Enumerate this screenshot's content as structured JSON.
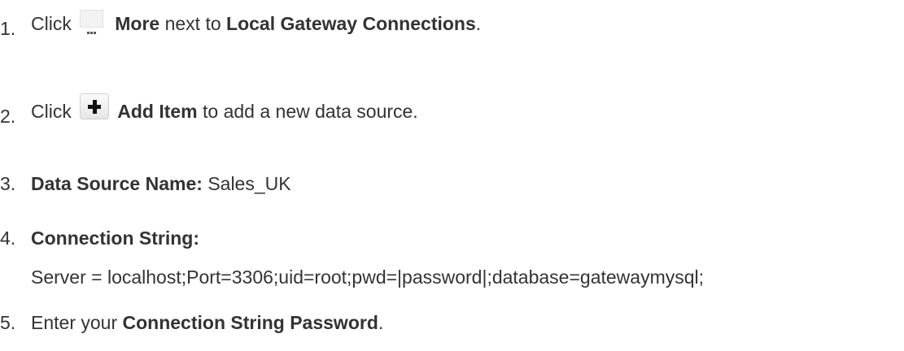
{
  "steps": [
    {
      "number": "1.",
      "prefix": "Click",
      "icon": "more-ellipsis-icon",
      "bold_1": "More",
      "middle": "next to",
      "bold_2": "Local Gateway Connections",
      "suffix": "."
    },
    {
      "number": "2.",
      "prefix": "Click",
      "icon": "add-plus-icon",
      "bold_1": "Add Item",
      "suffix": "to add a new data source."
    },
    {
      "number": "3.",
      "label": "Data Source Name:",
      "value": "Sales_UK"
    },
    {
      "number": "4.",
      "label": "Connection String:",
      "value": "Server = localhost;Port=3306;uid=root;pwd=|password|;database=gatewaymysql;"
    },
    {
      "number": "5.",
      "prefix": "Enter your",
      "bold_1": "Connection String Password",
      "suffix": "."
    }
  ]
}
